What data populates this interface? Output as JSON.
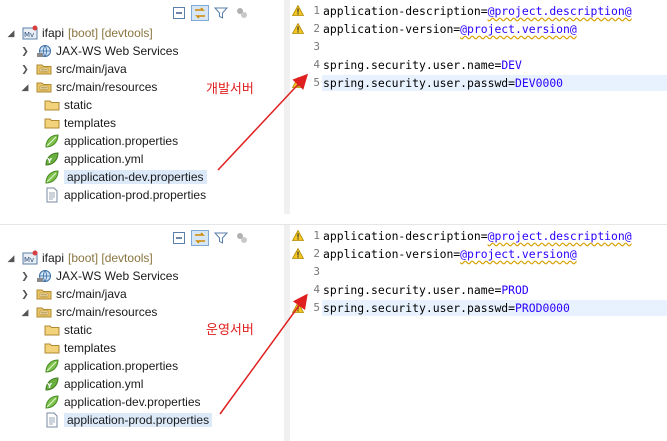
{
  "panels": [
    {
      "project": {
        "name": "ifapi",
        "decorations": "[boot] [devtools]"
      },
      "tree": [
        {
          "label": "JAX-WS Web Services",
          "icon": "web-services-icon",
          "expanded": false,
          "depth": 1
        },
        {
          "label": "src/main/java",
          "icon": "source-folder-icon",
          "expanded": false,
          "depth": 1
        },
        {
          "label": "src/main/resources",
          "icon": "source-folder-icon",
          "expanded": true,
          "depth": 1
        },
        {
          "label": "static",
          "icon": "folder-icon",
          "depth": 2
        },
        {
          "label": "templates",
          "icon": "folder-icon",
          "depth": 2
        },
        {
          "label": "application.properties",
          "icon": "spring-leaf-icon",
          "depth": 2
        },
        {
          "label": "application.yml",
          "icon": "spring-yml-icon",
          "depth": 2
        },
        {
          "label": "application-dev.properties",
          "icon": "spring-leaf-icon",
          "depth": 2,
          "selected": true
        },
        {
          "label": "application-prod.properties",
          "icon": "properties-file-icon",
          "depth": 2
        }
      ],
      "annotation": "개발서버",
      "editor": {
        "lines": [
          {
            "num": "1",
            "key": "application-description=",
            "value": "@project.description@",
            "placeholder": true,
            "warning": true
          },
          {
            "num": "2",
            "key": "application-version=",
            "value": "@project.version@",
            "placeholder": true,
            "warning": true
          },
          {
            "num": "3",
            "key": "",
            "value": "",
            "placeholder": false,
            "warning": false
          },
          {
            "num": "4",
            "key": "spring.security.user.name=",
            "value": "DEV",
            "placeholder": false,
            "warning": false
          },
          {
            "num": "5",
            "key": "spring.security.user.passwd=",
            "value": "DEV0000",
            "placeholder": false,
            "warning": true,
            "current": true
          }
        ]
      }
    },
    {
      "project": {
        "name": "ifapi",
        "decorations": "[boot] [devtools]"
      },
      "tree": [
        {
          "label": "JAX-WS Web Services",
          "icon": "web-services-icon",
          "expanded": false,
          "depth": 1
        },
        {
          "label": "src/main/java",
          "icon": "source-folder-icon",
          "expanded": false,
          "depth": 1
        },
        {
          "label": "src/main/resources",
          "icon": "source-folder-icon",
          "expanded": true,
          "depth": 1
        },
        {
          "label": "static",
          "icon": "folder-icon",
          "depth": 2
        },
        {
          "label": "templates",
          "icon": "folder-icon",
          "depth": 2
        },
        {
          "label": "application.properties",
          "icon": "spring-leaf-icon",
          "depth": 2
        },
        {
          "label": "application.yml",
          "icon": "spring-yml-icon",
          "depth": 2
        },
        {
          "label": "application-dev.properties",
          "icon": "spring-leaf-icon",
          "depth": 2
        },
        {
          "label": "application-prod.properties",
          "icon": "properties-file-icon",
          "depth": 2,
          "selected": true
        }
      ],
      "annotation": "운영서버",
      "editor": {
        "lines": [
          {
            "num": "1",
            "key": "application-description=",
            "value": "@project.description@",
            "placeholder": true,
            "warning": true
          },
          {
            "num": "2",
            "key": "application-version=",
            "value": "@project.version@",
            "placeholder": true,
            "warning": true
          },
          {
            "num": "3",
            "key": "",
            "value": "",
            "placeholder": false,
            "warning": false
          },
          {
            "num": "4",
            "key": "spring.security.user.name=",
            "value": "PROD",
            "placeholder": false,
            "warning": false
          },
          {
            "num": "5",
            "key": "spring.security.user.passwd=",
            "value": "PROD0000",
            "placeholder": false,
            "warning": true,
            "current": true
          }
        ]
      }
    }
  ],
  "colors": {
    "annotation": "#e02020",
    "value": "#2a00ff",
    "selection": "#dbe9f9",
    "current_line": "#e8f2fe"
  }
}
